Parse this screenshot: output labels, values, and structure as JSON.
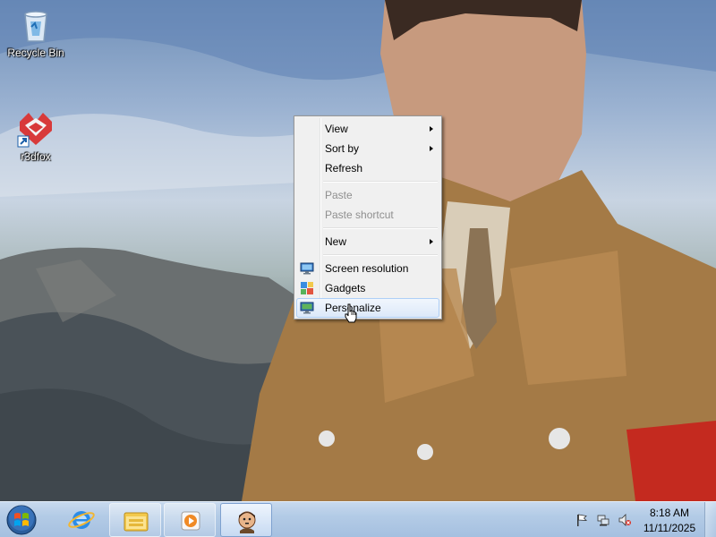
{
  "desktop": {
    "icons": [
      {
        "label": "Recycle Bin",
        "icon": "recycle-bin-icon"
      },
      {
        "label": "r3dfox",
        "icon": "r3dfox-icon"
      }
    ]
  },
  "context_menu": {
    "items": [
      {
        "label": "View",
        "submenu": true
      },
      {
        "label": "Sort by",
        "submenu": true
      },
      {
        "label": "Refresh"
      },
      {
        "label": "Paste",
        "disabled": true
      },
      {
        "label": "Paste shortcut",
        "disabled": true
      },
      {
        "label": "New",
        "submenu": true
      },
      {
        "label": "Screen resolution",
        "icon": "screen-resolution-icon"
      },
      {
        "label": "Gadgets",
        "icon": "gadgets-icon"
      },
      {
        "label": "Personalize",
        "icon": "personalize-icon",
        "highlighted": true
      }
    ]
  },
  "taskbar": {
    "pinned": [
      "start-orb-icon",
      "internet-explorer-icon",
      "windows-explorer-icon",
      "media-player-icon",
      "app-portrait-icon"
    ],
    "clock": {
      "time": "8:18 AM",
      "date": "11/11/2025"
    },
    "tray": [
      "action-center-flag-icon",
      "network-icon",
      "volume-muted-icon"
    ]
  },
  "colors": {
    "taskbar": "#b3cbe6",
    "menu_background": "#f0f0f0",
    "menu_highlight": "#dce9f9"
  }
}
